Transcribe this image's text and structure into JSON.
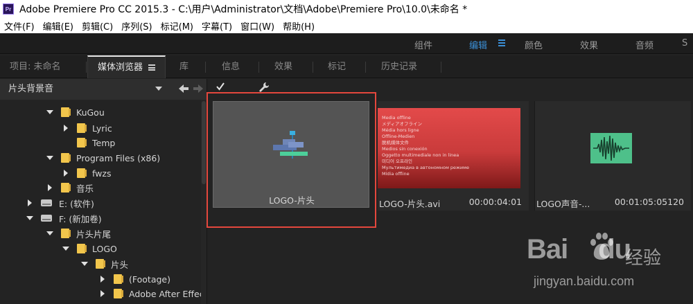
{
  "window": {
    "title": "Adobe Premiere Pro CC 2015.3 - C:\\用户\\Administrator\\文档\\Adobe\\Premiere Pro\\10.0\\未命名 *",
    "app_icon_text": "Pr"
  },
  "menubar": {
    "items": [
      {
        "label": "文件(F)"
      },
      {
        "label": "编辑(E)"
      },
      {
        "label": "剪辑(C)"
      },
      {
        "label": "序列(S)"
      },
      {
        "label": "标记(M)"
      },
      {
        "label": "字幕(T)"
      },
      {
        "label": "窗口(W)"
      },
      {
        "label": "帮助(H)"
      }
    ]
  },
  "workspace": {
    "tabs": [
      {
        "label": "组件",
        "active": false
      },
      {
        "label": "编辑",
        "active": true
      },
      {
        "label": "颜色",
        "active": false
      },
      {
        "label": "效果",
        "active": false
      },
      {
        "label": "音频",
        "active": false
      },
      {
        "label": "S",
        "active": false
      }
    ]
  },
  "panel_tabs": [
    {
      "label": "项目: 未命名",
      "active": false
    },
    {
      "label": "媒体浏览器",
      "active": true
    },
    {
      "label": "库",
      "active": false
    },
    {
      "label": "信息",
      "active": false
    },
    {
      "label": "效果",
      "active": false
    },
    {
      "label": "标记",
      "active": false
    },
    {
      "label": "历史记录",
      "active": false
    }
  ],
  "location": {
    "selected": "片头背景音"
  },
  "tree": [
    {
      "label": "KuGou",
      "kind": "folder",
      "expanded": true
    },
    {
      "label": "Lyric",
      "kind": "folder",
      "expanded": false
    },
    {
      "label": "Temp",
      "kind": "folder",
      "expanded": null
    },
    {
      "label": "Program Files (x86)",
      "kind": "folder",
      "expanded": true
    },
    {
      "label": "fwzs",
      "kind": "folder",
      "expanded": false
    },
    {
      "label": "音乐",
      "kind": "folder",
      "expanded": false
    },
    {
      "label": "E: (软件)",
      "kind": "drive",
      "expanded": false
    },
    {
      "label": "F: (新加卷)",
      "kind": "drive",
      "expanded": true
    },
    {
      "label": "片头片尾",
      "kind": "folder",
      "expanded": true
    },
    {
      "label": "LOGO",
      "kind": "folder",
      "expanded": true
    },
    {
      "label": "片头",
      "kind": "folder",
      "expanded": true
    },
    {
      "label": "(Footage)",
      "kind": "folder",
      "expanded": false
    },
    {
      "label": "Adobe After Effec",
      "kind": "folder",
      "expanded": false
    }
  ],
  "media": [
    {
      "name": "LOGO-片头",
      "duration": "",
      "selected": true,
      "thumb": "logo-project"
    },
    {
      "name": "LOGO-片头.avi",
      "duration": "00:00:04:01",
      "selected": false,
      "thumb": "video",
      "thumb_text": [
        "Media offline",
        "メディアオフライン",
        "Média hors ligne",
        "Offline-Medien",
        "脱机媒体文件",
        "Medios sin conexión",
        "Oggetto multimediale non in linea",
        "미디어 오프라인",
        "Мультимедиа в автономном режиме",
        "Mídia offline"
      ]
    },
    {
      "name": "LOGO声音-...",
      "duration": "00:01:05:05120",
      "selected": false,
      "thumb": "audio"
    }
  ],
  "watermark": {
    "brand": "Bai",
    "brand_suffix": "du",
    "cn": "经验",
    "url": "jingyan.baidu.com"
  },
  "colors": {
    "accent": "#3b8fd6",
    "selection": "#e5473d",
    "folder": "#f2c64c"
  }
}
